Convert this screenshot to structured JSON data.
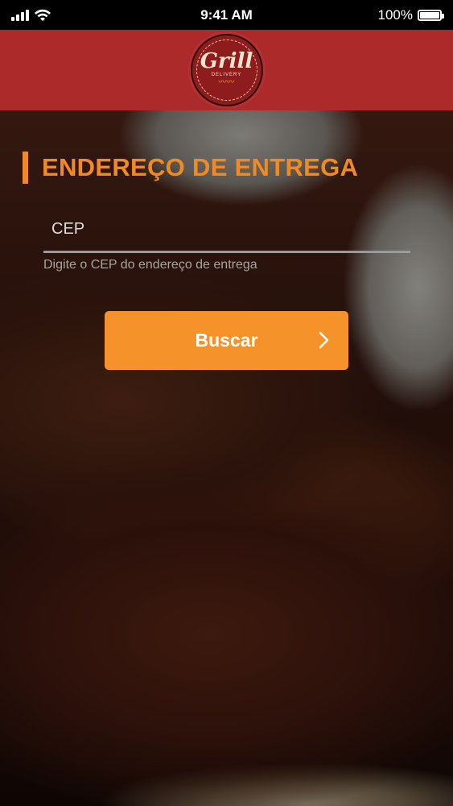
{
  "status_bar": {
    "time": "9:41 AM",
    "battery": "100%"
  },
  "header": {
    "logo_text": "Grill",
    "logo_subtext": "DELIVERY"
  },
  "form": {
    "title": "ENDEREÇO DE ENTREGA",
    "cep_label": "CEP",
    "helper_text": "Digite o CEP do endereço de entrega",
    "submit_label": "Buscar"
  },
  "colors": {
    "header": "#ad2a2a",
    "accent": "#f08a24",
    "button": "#f6922a"
  }
}
